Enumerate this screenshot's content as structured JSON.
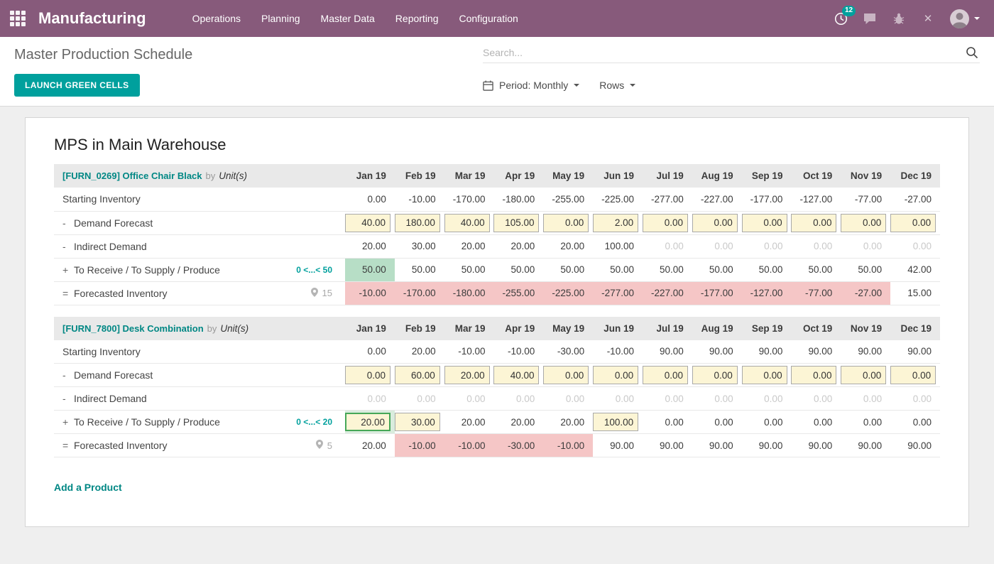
{
  "navbar": {
    "app_name": "Manufacturing",
    "menu_items": [
      "Operations",
      "Planning",
      "Master Data",
      "Reporting",
      "Configuration"
    ],
    "activity_badge": "12",
    "close_glyph": "✕"
  },
  "control_panel": {
    "title": "Master Production Schedule",
    "search_placeholder": "Search...",
    "launch_button_label": "LAUNCH GREEN CELLS",
    "period_button_label": "Period: Monthly",
    "rows_button_label": "Rows"
  },
  "colors": {
    "navbar_bg": "#875A7B",
    "accent_teal": "#00A09D",
    "input_bg": "#FCF5D5",
    "success_bg": "#B7DEC6",
    "danger_bg": "#F5C6C6"
  },
  "cell_styles": {
    "t": "text",
    "m": "muted-text",
    "i": "input",
    "if": "input-focused",
    "g": "success-bg",
    "r": "danger-bg"
  },
  "mps": {
    "heading": "MPS in Main Warehouse",
    "add_product_label": "Add a Product",
    "months": [
      "Jan 19",
      "Feb 19",
      "Mar 19",
      "Apr 19",
      "May 19",
      "Jun 19",
      "Jul 19",
      "Aug 19",
      "Sep 19",
      "Oct 19",
      "Nov 19",
      "Dec 19"
    ],
    "row_labels": {
      "starting_inventory": "Starting Inventory",
      "demand_forecast": "Demand Forecast",
      "indirect_demand": "Indirect Demand",
      "to_receive": "To Receive / To Supply / Produce",
      "forecasted_inventory": "Forecasted Inventory"
    },
    "products": [
      {
        "name": "[FURN_0269] Office Chair Black",
        "by_label": "by",
        "uom": "Unit(s)",
        "supply_range": "0 <...< 50",
        "forecast_pin": "15",
        "starting_inventory": [
          {
            "v": "0.00",
            "s": "t"
          },
          {
            "v": "-10.00",
            "s": "t"
          },
          {
            "v": "-170.00",
            "s": "t"
          },
          {
            "v": "-180.00",
            "s": "t"
          },
          {
            "v": "-255.00",
            "s": "t"
          },
          {
            "v": "-225.00",
            "s": "t"
          },
          {
            "v": "-277.00",
            "s": "t"
          },
          {
            "v": "-227.00",
            "s": "t"
          },
          {
            "v": "-177.00",
            "s": "t"
          },
          {
            "v": "-127.00",
            "s": "t"
          },
          {
            "v": "-77.00",
            "s": "t"
          },
          {
            "v": "-27.00",
            "s": "t"
          }
        ],
        "demand_forecast": [
          {
            "v": "40.00",
            "s": "i"
          },
          {
            "v": "180.00",
            "s": "i"
          },
          {
            "v": "40.00",
            "s": "i"
          },
          {
            "v": "105.00",
            "s": "i"
          },
          {
            "v": "0.00",
            "s": "i"
          },
          {
            "v": "2.00",
            "s": "i"
          },
          {
            "v": "0.00",
            "s": "i"
          },
          {
            "v": "0.00",
            "s": "i"
          },
          {
            "v": "0.00",
            "s": "i"
          },
          {
            "v": "0.00",
            "s": "i"
          },
          {
            "v": "0.00",
            "s": "i"
          },
          {
            "v": "0.00",
            "s": "i"
          }
        ],
        "indirect_demand": [
          {
            "v": "20.00",
            "s": "t"
          },
          {
            "v": "30.00",
            "s": "t"
          },
          {
            "v": "20.00",
            "s": "t"
          },
          {
            "v": "20.00",
            "s": "t"
          },
          {
            "v": "20.00",
            "s": "t"
          },
          {
            "v": "100.00",
            "s": "t"
          },
          {
            "v": "0.00",
            "s": "m"
          },
          {
            "v": "0.00",
            "s": "m"
          },
          {
            "v": "0.00",
            "s": "m"
          },
          {
            "v": "0.00",
            "s": "m"
          },
          {
            "v": "0.00",
            "s": "m"
          },
          {
            "v": "0.00",
            "s": "m"
          }
        ],
        "to_receive": [
          {
            "v": "50.00",
            "s": "g"
          },
          {
            "v": "50.00",
            "s": "t"
          },
          {
            "v": "50.00",
            "s": "t"
          },
          {
            "v": "50.00",
            "s": "t"
          },
          {
            "v": "50.00",
            "s": "t"
          },
          {
            "v": "50.00",
            "s": "t"
          },
          {
            "v": "50.00",
            "s": "t"
          },
          {
            "v": "50.00",
            "s": "t"
          },
          {
            "v": "50.00",
            "s": "t"
          },
          {
            "v": "50.00",
            "s": "t"
          },
          {
            "v": "50.00",
            "s": "t"
          },
          {
            "v": "42.00",
            "s": "t"
          }
        ],
        "forecasted_inventory": [
          {
            "v": "-10.00",
            "s": "r"
          },
          {
            "v": "-170.00",
            "s": "r"
          },
          {
            "v": "-180.00",
            "s": "r"
          },
          {
            "v": "-255.00",
            "s": "r"
          },
          {
            "v": "-225.00",
            "s": "r"
          },
          {
            "v": "-277.00",
            "s": "r"
          },
          {
            "v": "-227.00",
            "s": "r"
          },
          {
            "v": "-177.00",
            "s": "r"
          },
          {
            "v": "-127.00",
            "s": "r"
          },
          {
            "v": "-77.00",
            "s": "r"
          },
          {
            "v": "-27.00",
            "s": "r"
          },
          {
            "v": "15.00",
            "s": "t"
          }
        ]
      },
      {
        "name": "[FURN_7800] Desk Combination",
        "by_label": "by",
        "uom": "Unit(s)",
        "supply_range": "0 <...< 20",
        "forecast_pin": "5",
        "starting_inventory": [
          {
            "v": "0.00",
            "s": "t"
          },
          {
            "v": "20.00",
            "s": "t"
          },
          {
            "v": "-10.00",
            "s": "t"
          },
          {
            "v": "-10.00",
            "s": "t"
          },
          {
            "v": "-30.00",
            "s": "t"
          },
          {
            "v": "-10.00",
            "s": "t"
          },
          {
            "v": "90.00",
            "s": "t"
          },
          {
            "v": "90.00",
            "s": "t"
          },
          {
            "v": "90.00",
            "s": "t"
          },
          {
            "v": "90.00",
            "s": "t"
          },
          {
            "v": "90.00",
            "s": "t"
          },
          {
            "v": "90.00",
            "s": "t"
          }
        ],
        "demand_forecast": [
          {
            "v": "0.00",
            "s": "i"
          },
          {
            "v": "60.00",
            "s": "i"
          },
          {
            "v": "20.00",
            "s": "i"
          },
          {
            "v": "40.00",
            "s": "i"
          },
          {
            "v": "0.00",
            "s": "i"
          },
          {
            "v": "0.00",
            "s": "i"
          },
          {
            "v": "0.00",
            "s": "i"
          },
          {
            "v": "0.00",
            "s": "i"
          },
          {
            "v": "0.00",
            "s": "i"
          },
          {
            "v": "0.00",
            "s": "i"
          },
          {
            "v": "0.00",
            "s": "i"
          },
          {
            "v": "0.00",
            "s": "i"
          }
        ],
        "indirect_demand": [
          {
            "v": "0.00",
            "s": "m"
          },
          {
            "v": "0.00",
            "s": "m"
          },
          {
            "v": "0.00",
            "s": "m"
          },
          {
            "v": "0.00",
            "s": "m"
          },
          {
            "v": "0.00",
            "s": "m"
          },
          {
            "v": "0.00",
            "s": "m"
          },
          {
            "v": "0.00",
            "s": "m"
          },
          {
            "v": "0.00",
            "s": "m"
          },
          {
            "v": "0.00",
            "s": "m"
          },
          {
            "v": "0.00",
            "s": "m"
          },
          {
            "v": "0.00",
            "s": "m"
          },
          {
            "v": "0.00",
            "s": "m"
          }
        ],
        "to_receive": [
          {
            "v": "20.00",
            "s": "if"
          },
          {
            "v": "30.00",
            "s": "i"
          },
          {
            "v": "20.00",
            "s": "t"
          },
          {
            "v": "20.00",
            "s": "t"
          },
          {
            "v": "20.00",
            "s": "t"
          },
          {
            "v": "100.00",
            "s": "i"
          },
          {
            "v": "0.00",
            "s": "t"
          },
          {
            "v": "0.00",
            "s": "t"
          },
          {
            "v": "0.00",
            "s": "t"
          },
          {
            "v": "0.00",
            "s": "t"
          },
          {
            "v": "0.00",
            "s": "t"
          },
          {
            "v": "0.00",
            "s": "t"
          }
        ],
        "forecasted_inventory": [
          {
            "v": "20.00",
            "s": "t"
          },
          {
            "v": "-10.00",
            "s": "r"
          },
          {
            "v": "-10.00",
            "s": "r"
          },
          {
            "v": "-30.00",
            "s": "r"
          },
          {
            "v": "-10.00",
            "s": "r"
          },
          {
            "v": "90.00",
            "s": "t"
          },
          {
            "v": "90.00",
            "s": "t"
          },
          {
            "v": "90.00",
            "s": "t"
          },
          {
            "v": "90.00",
            "s": "t"
          },
          {
            "v": "90.00",
            "s": "t"
          },
          {
            "v": "90.00",
            "s": "t"
          },
          {
            "v": "90.00",
            "s": "t"
          }
        ]
      }
    ]
  }
}
